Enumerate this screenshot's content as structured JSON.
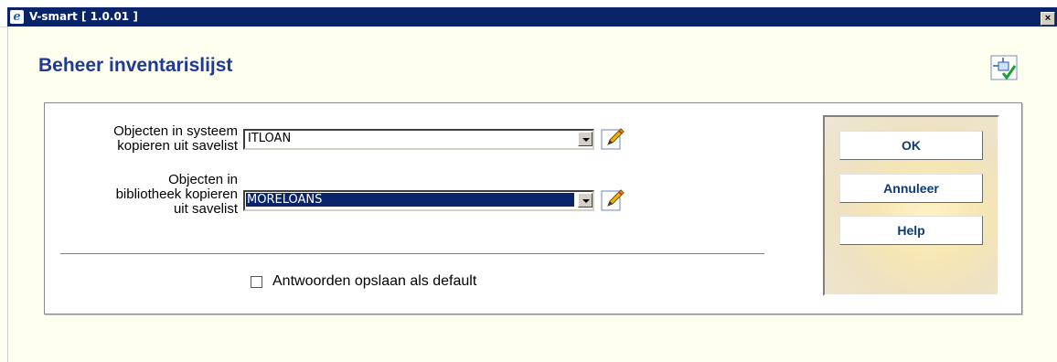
{
  "window": {
    "title": "V-smart [ 1.0.01 ]",
    "close_glyph": "×"
  },
  "page": {
    "title": "Beheer inventarislijst"
  },
  "fields": [
    {
      "label_lines": [
        "Objecten in systeem",
        "kopieren uit savelist"
      ],
      "value": "ITLOAN"
    },
    {
      "label_lines": [
        "Objecten in",
        "bibliotheek kopieren",
        "uit savelist"
      ],
      "value": "MORELOANS"
    }
  ],
  "options": {
    "default_label": "Antwoorden opslaan als default"
  },
  "buttons": {
    "ok": "OK",
    "cancel": "Annuleer",
    "help": "Help"
  },
  "icons": {
    "app": "ie-icon",
    "help": "help-icon",
    "edit": "pencil-icon",
    "close": "close-icon"
  },
  "colors": {
    "title": "#1f3a93",
    "titlebar": "#0a246a",
    "button_text": "#0f3a6e",
    "selection": "#0a246a"
  }
}
